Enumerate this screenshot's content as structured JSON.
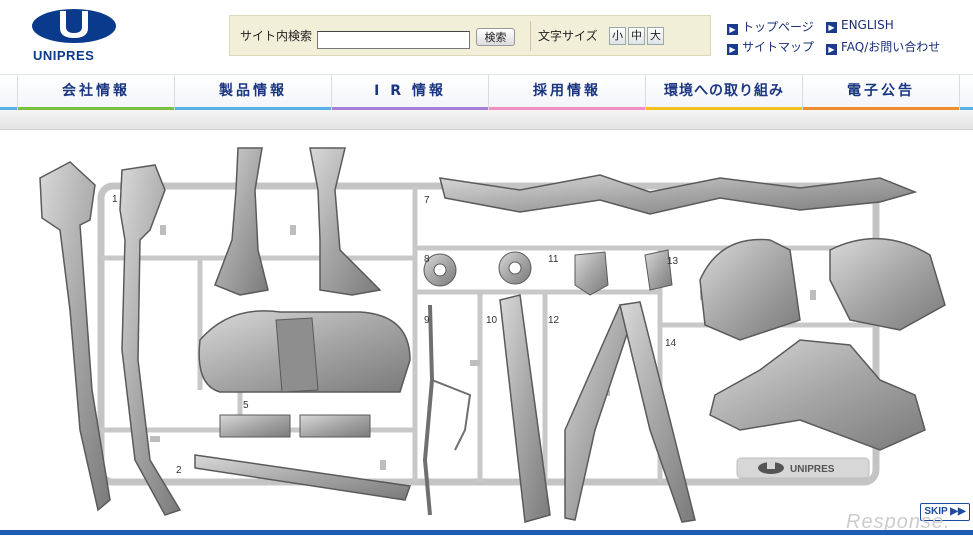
{
  "header": {
    "logo_text": "UNIPRES",
    "search_label": "サイト内検索",
    "search_value": "",
    "search_button": "検索",
    "font_size_label": "文字サイズ",
    "font_sizes": [
      "小",
      "中",
      "大"
    ]
  },
  "top_links": [
    {
      "label": "トップページ"
    },
    {
      "label": "ENGLISH"
    },
    {
      "label": "サイトマップ"
    },
    {
      "label": "FAQ/お問い合わせ"
    }
  ],
  "nav": {
    "items": [
      {
        "label": "会社情報",
        "color": "#7ac143"
      },
      {
        "label": "製品情報",
        "color": "#5aaee8"
      },
      {
        "label": "I R 情報",
        "color": "#a77fd8"
      },
      {
        "label": "採用情報",
        "color": "#f08fc0"
      },
      {
        "label": "環境への取り組み",
        "color": "#f4c020"
      },
      {
        "label": "電子公告",
        "color": "#f08c2e"
      }
    ]
  },
  "hero": {
    "part_numbers": [
      "1",
      "2",
      "5",
      "7",
      "8",
      "9",
      "10",
      "11",
      "12",
      "13",
      "14"
    ],
    "plate_logo": "UNIPRES",
    "skip_button": "SKIP ▶▶",
    "watermark": "Response."
  },
  "colors": {
    "brand_blue": "#0a3a8c",
    "nav_text": "#1b3680",
    "bottom_bar": "#1d5bb4"
  }
}
